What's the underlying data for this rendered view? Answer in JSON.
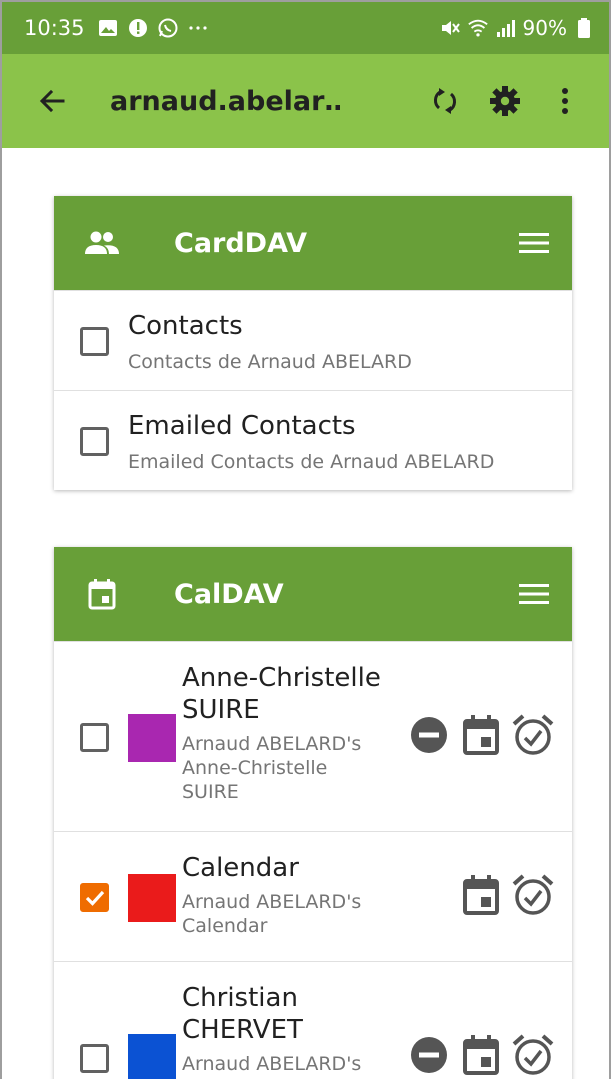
{
  "status_bar": {
    "time": "10:35",
    "battery": "90%",
    "left_icons": [
      "image-icon",
      "alert-icon",
      "whatsapp-icon",
      "more-dots-icon"
    ],
    "right_icons": [
      "mute-icon",
      "wifi-icon",
      "signal-icon",
      "battery-icon"
    ]
  },
  "app_bar": {
    "title": "arnaud.abelar…",
    "actions": [
      "sync-icon",
      "settings-icon",
      "overflow-menu-icon"
    ]
  },
  "carddav": {
    "title": "CardDAV",
    "items": [
      {
        "title": "Contacts",
        "subtitle": "Contacts de Arnaud ABELARD",
        "checked": false
      },
      {
        "title": "Emailed Contacts",
        "subtitle": "Emailed Contacts de Arnaud ABELARD",
        "checked": false
      }
    ]
  },
  "caldav": {
    "title": "CalDAV",
    "items": [
      {
        "title": "Anne-Christelle SUIRE",
        "subtitle": "Arnaud ABELARD's Anne-Christelle SUIRE",
        "checked": false,
        "color": "#a927b0",
        "read_only": true
      },
      {
        "title": "Calendar",
        "subtitle": "Arnaud ABELARD's Calendar",
        "checked": true,
        "color": "#ea1b1b",
        "read_only": false
      },
      {
        "title": "Christian CHERVET",
        "subtitle": "Arnaud ABELARD's",
        "checked": false,
        "color": "#0b52d3",
        "read_only": true
      }
    ]
  },
  "colors": {
    "primary": "#8bc34a",
    "primary_dark": "#689f38",
    "accent": "#ef6c00"
  }
}
